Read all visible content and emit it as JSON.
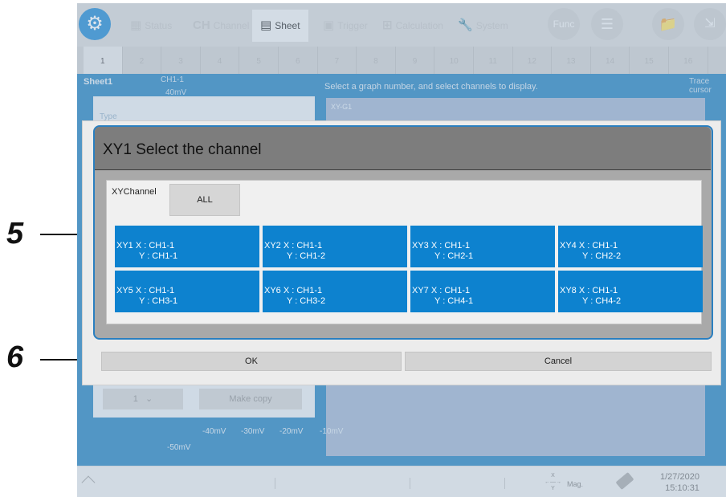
{
  "callouts": {
    "step5": "5",
    "step6": "6"
  },
  "topbar": {
    "tabs": [
      {
        "label": "Status",
        "glyph": ""
      },
      {
        "label": "Channel",
        "glyph": "CH"
      },
      {
        "label": "Sheet",
        "glyph": ""
      },
      {
        "label": "Trigger",
        "glyph": ""
      },
      {
        "label": "Calculation",
        "glyph": ""
      },
      {
        "label": "System",
        "glyph": ""
      }
    ],
    "func_label": "Func"
  },
  "sheet_tabs": [
    "1",
    "2",
    "3",
    "4",
    "5",
    "6",
    "7",
    "8",
    "9",
    "10",
    "11",
    "12",
    "13",
    "14",
    "15",
    "16"
  ],
  "background": {
    "sheet_title": "Sheet1",
    "ch_label": "CH1-1",
    "mv_label": "40mV",
    "hint": "Select a graph number, and select channels to display.",
    "trace_label": "Trace cursor",
    "graph_label": "XY-G1",
    "type_label": "Type",
    "copy_value": "1",
    "make_copy": "Make copy",
    "axis_label": "-50mV",
    "axis_ticks": [
      "-40mV",
      "-30mV",
      "-20mV",
      "-10mV"
    ]
  },
  "dialog": {
    "title": "XY1   Select the channel",
    "xychannel_label": "XYChannel",
    "all_label": "ALL",
    "channels": [
      {
        "x": "XY1  X : CH1-1",
        "y": "Y : CH1-1"
      },
      {
        "x": "XY2  X : CH1-1",
        "y": "Y : CH1-2"
      },
      {
        "x": "XY3  X : CH1-1",
        "y": "Y : CH2-1"
      },
      {
        "x": "XY4  X : CH1-1",
        "y": "Y : CH2-2"
      },
      {
        "x": "XY5  X : CH1-1",
        "y": "Y : CH3-1"
      },
      {
        "x": "XY6  X : CH1-1",
        "y": "Y : CH3-2"
      },
      {
        "x": "XY7  X : CH1-1",
        "y": "Y : CH4-1"
      },
      {
        "x": "XY8  X : CH1-1",
        "y": "Y : CH4-2"
      }
    ],
    "ok_label": "OK",
    "cancel_label": "Cancel"
  },
  "statusbar": {
    "mag_label": "Mag.",
    "mag_x": "X",
    "mag_y": "Y",
    "date": "1/27/2020",
    "time": "15:10:31"
  },
  "colors": {
    "accent": "#0d82cf",
    "frame": "#2a7fc0",
    "screen_bg": "#2e89c4"
  }
}
